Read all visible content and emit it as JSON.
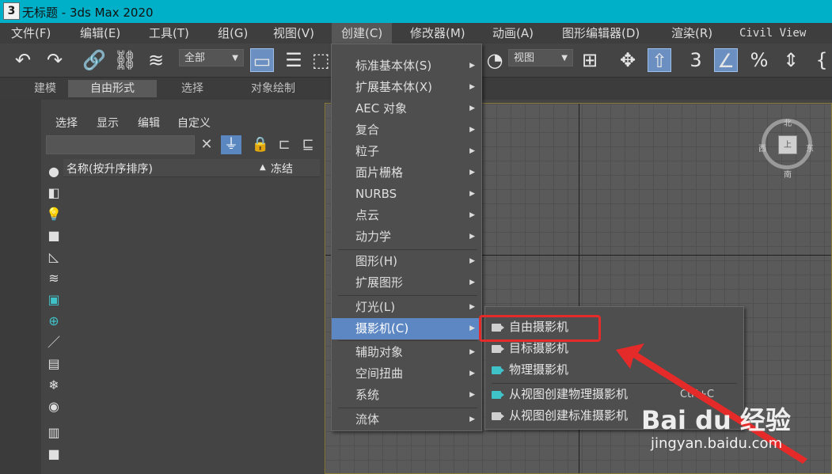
{
  "window": {
    "title": "无标题 - 3ds Max 2020",
    "icon_text": "3"
  },
  "menubar": {
    "items": [
      "文件(F)",
      "编辑(E)",
      "工具(T)",
      "组(G)",
      "视图(V)",
      "创建(C)",
      "修改器(M)",
      "动画(A)",
      "图形编辑器(D)",
      "渲染(R)",
      "Civil View"
    ],
    "active_index": 5
  },
  "toolbar": {
    "selection_filter": "全部",
    "reference_coord": "视图"
  },
  "ribbon": {
    "tabs": [
      "建模",
      "自由形式",
      "选择",
      "对象绘制"
    ],
    "active_index": 1
  },
  "explorer": {
    "tabs": [
      "选择",
      "显示",
      "编辑",
      "自定义"
    ],
    "columns": {
      "name": "名称(按升序排序)",
      "sort_marker": "▲",
      "frozen": "冻结"
    }
  },
  "viewcube": {
    "north": "北",
    "south": "南",
    "west": "西",
    "east": "东",
    "face": "上"
  },
  "create_menu": {
    "items": [
      {
        "label": "标准基本体(S)",
        "has_submenu": true
      },
      {
        "label": "扩展基本体(X)",
        "has_submenu": true
      },
      {
        "label": "AEC 对象",
        "has_submenu": true
      },
      {
        "label": "复合",
        "has_submenu": true
      },
      {
        "label": "粒子",
        "has_submenu": true
      },
      {
        "label": "面片栅格",
        "has_submenu": true
      },
      {
        "label": "NURBS",
        "has_submenu": true
      },
      {
        "label": "点云",
        "has_submenu": true
      },
      {
        "label": "动力学",
        "has_submenu": true
      },
      {
        "label": "图形(H)",
        "has_submenu": true
      },
      {
        "label": "扩展图形",
        "has_submenu": true
      },
      {
        "label": "灯光(L)",
        "has_submenu": true
      },
      {
        "label": "摄影机(C)",
        "has_submenu": true,
        "highlighted": true
      },
      {
        "label": "辅助对象",
        "has_submenu": true
      },
      {
        "label": "空间扭曲",
        "has_submenu": true
      },
      {
        "label": "系统",
        "has_submenu": true
      },
      {
        "label": "流体",
        "has_submenu": true
      }
    ]
  },
  "camera_submenu": {
    "items": [
      {
        "label": "自由摄影机",
        "icon": "camera-icon"
      },
      {
        "label": "目标摄影机",
        "icon": "target-camera-icon"
      },
      {
        "label": "物理摄影机",
        "icon": "physical-camera-icon"
      },
      {
        "label": "从视图创建物理摄影机",
        "icon": "physical-camera-icon",
        "shortcut": "Ctrl+C"
      },
      {
        "label": "从视图创建标准摄影机",
        "icon": "camera-icon"
      }
    ]
  },
  "annotation": {
    "color": "#e52a2a"
  },
  "watermark": {
    "logo": "Bai du 经验",
    "url": "jingyan.baidu.com"
  },
  "colors": {
    "titlebar": "#00b0c8",
    "highlight": "#5d87c3",
    "accent_teal": "#3fc3c9"
  }
}
